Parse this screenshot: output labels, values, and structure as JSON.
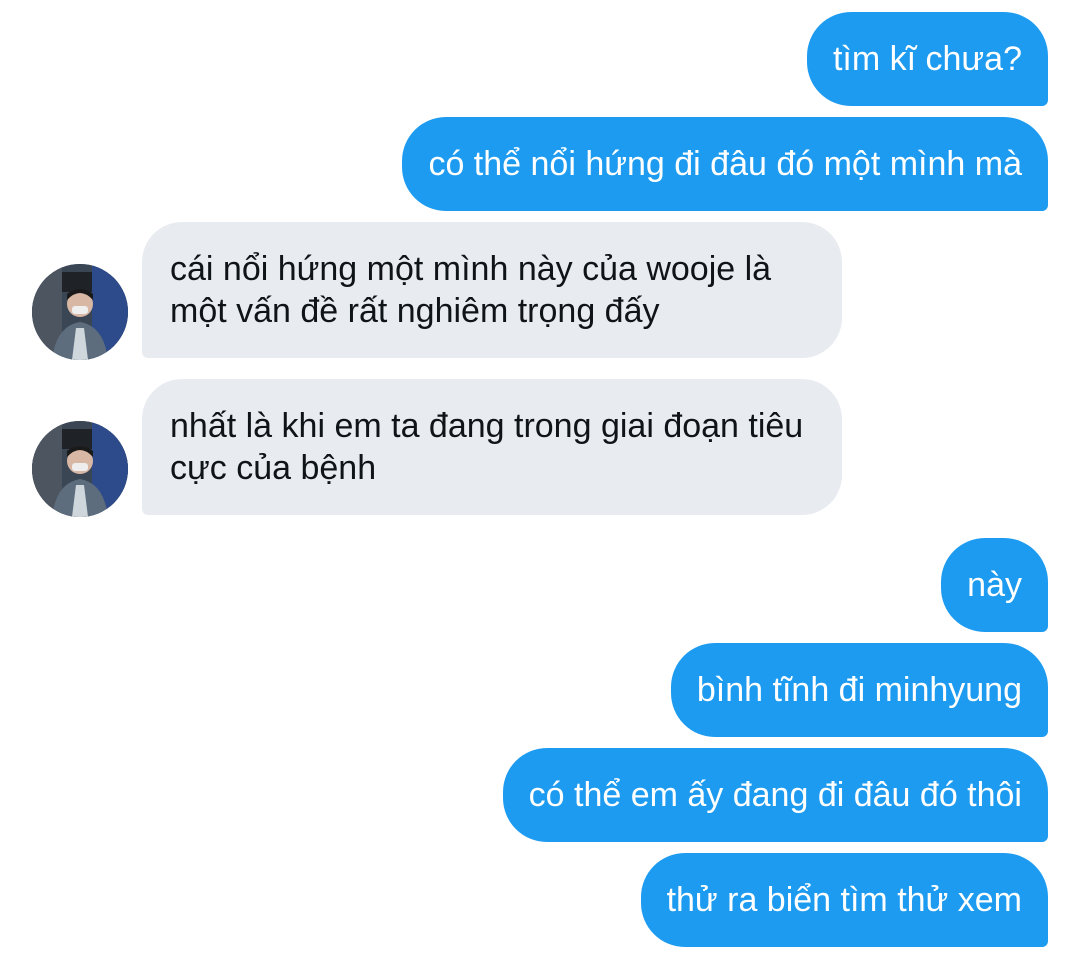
{
  "messages": [
    {
      "side": "sent",
      "text": "tìm kĩ chưa?"
    },
    {
      "side": "sent",
      "text": "có thể nổi hứng đi đâu đó một mình mà"
    },
    {
      "side": "received",
      "text": "cái nổi hứng một mình này của wooje là một vấn đề rất nghiêm trọng đấy",
      "avatar": "profile-photo"
    },
    {
      "side": "received",
      "text": "nhất là khi em ta đang trong giai đoạn tiêu cực của bệnh",
      "avatar": "profile-photo"
    },
    {
      "side": "sent",
      "text": "này"
    },
    {
      "side": "sent",
      "text": "bình tĩnh đi minhyung"
    },
    {
      "side": "sent",
      "text": "có thể em ấy đang đi đâu đó thôi"
    },
    {
      "side": "sent",
      "text": "thử ra biển tìm thử xem"
    }
  ],
  "colors": {
    "sent_bubble": "#1d9bf0",
    "sent_text": "#ffffff",
    "received_bubble": "#e8ecf0",
    "received_text": "#0f1419",
    "background": "#ffffff"
  }
}
